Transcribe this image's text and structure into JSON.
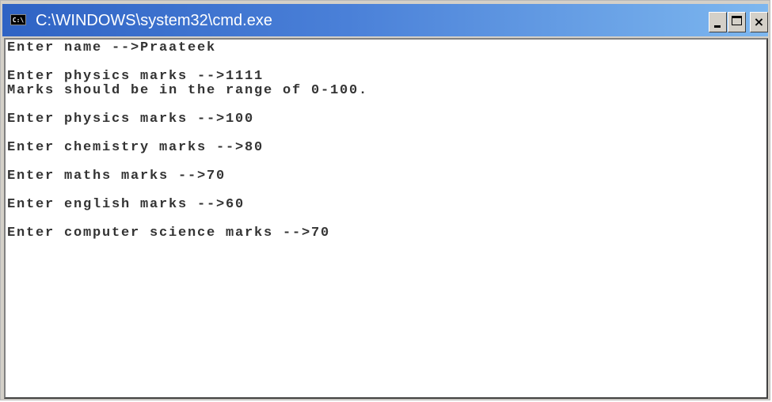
{
  "window": {
    "title": "C:\\WINDOWS\\system32\\cmd.exe",
    "icon": "cmd-icon",
    "icon_text": "C:\\"
  },
  "controls": {
    "minimize": "minimize-icon",
    "maximize": "maximize-icon",
    "close": "×"
  },
  "console": {
    "lines": [
      "Enter name -->Praateek",
      "",
      "Enter physics marks -->1111",
      "Marks should be in the range of 0-100.",
      "",
      "Enter physics marks -->100",
      "",
      "Enter chemistry marks -->80",
      "",
      "Enter maths marks -->70",
      "",
      "Enter english marks -->60",
      "",
      "Enter computer science marks -->70"
    ]
  }
}
